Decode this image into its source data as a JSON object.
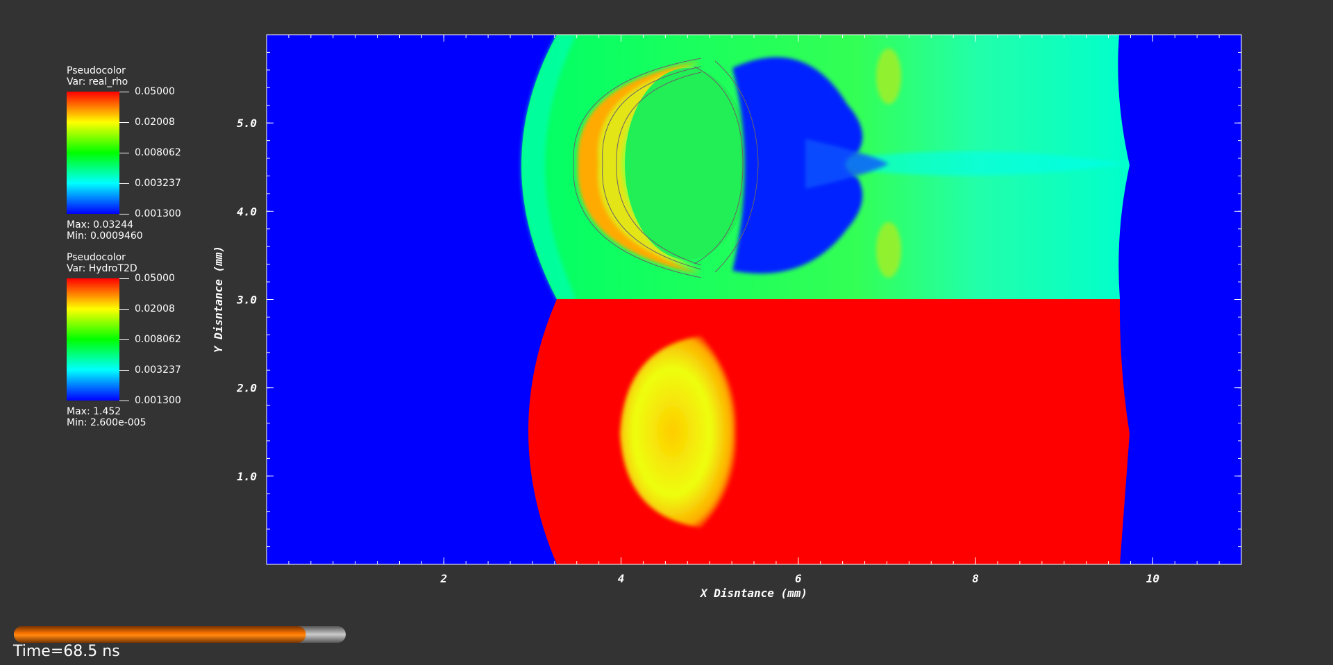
{
  "legends": [
    {
      "title": "Pseudocolor",
      "var_label": "Var: real_rho",
      "ticks": [
        "0.05000",
        "0.02008",
        "0.008062",
        "0.003237",
        "0.001300"
      ],
      "max_text": "Max:  0.03244",
      "min_text": "Min:  0.0009460"
    },
    {
      "title": "Pseudocolor",
      "var_label": "Var: HydroT2D",
      "ticks": [
        "0.05000",
        "0.02008",
        "0.008062",
        "0.003237",
        "0.001300"
      ],
      "max_text": "Max:  1.452",
      "min_text": "Min:  2.600e-005"
    }
  ],
  "colors": {
    "background": "#333333",
    "colormap": [
      "#ff0000",
      "#ffff00",
      "#00ff00",
      "#00ffff",
      "#0000ff"
    ]
  },
  "chart_data": {
    "type": "heatmap",
    "xlabel": "X Disntance (mm)",
    "ylabel": "Y Disntance (mm)",
    "xlim": [
      0,
      11
    ],
    "ylim": [
      0,
      6
    ],
    "x_ticks": [
      2,
      4,
      6,
      8,
      10
    ],
    "x_tick_labels": [
      "2",
      "4",
      "6",
      "8",
      "10"
    ],
    "y_ticks": [
      1,
      2,
      3,
      4,
      5
    ],
    "y_tick_labels": [
      "1.0",
      "2.0",
      "3.0",
      "4.0",
      "5.0"
    ],
    "split_y": 3.0,
    "grid": false
  },
  "time_label": "Time=68.5 ns",
  "time_progress": 0.88
}
